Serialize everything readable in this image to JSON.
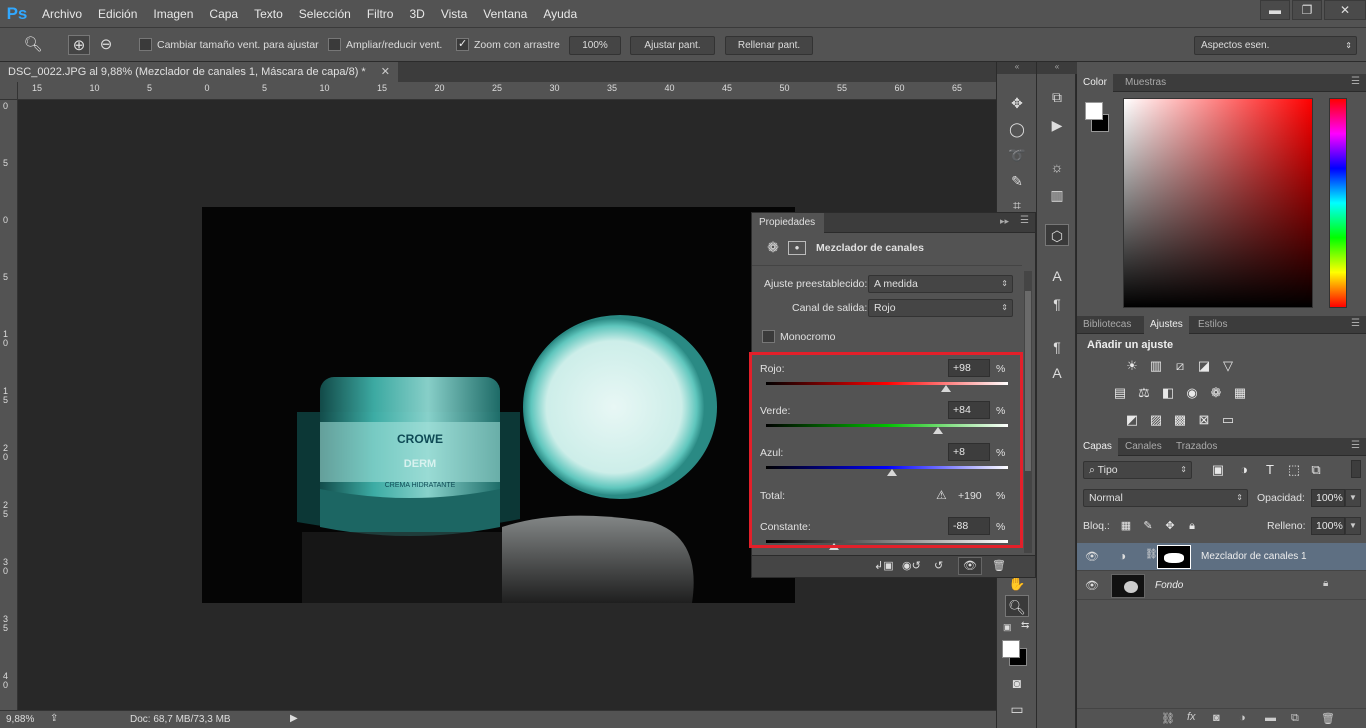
{
  "app": {
    "logo": "Ps",
    "menu": [
      "Archivo",
      "Edición",
      "Imagen",
      "Capa",
      "Texto",
      "Selección",
      "Filtro",
      "3D",
      "Vista",
      "Ventana",
      "Ayuda"
    ],
    "window_buttons": [
      "▬",
      "❐",
      "✕"
    ]
  },
  "options_bar": {
    "resize_windows_label": "Cambiar tamaño vent. para ajustar",
    "zoom_all_label": "Ampliar/reducir vent.",
    "scrubby_zoom_label": "Zoom con arrastre",
    "scrubby_zoom_checked": true,
    "btn_100": "100%",
    "btn_fit": "Ajustar pant.",
    "btn_fill": "Rellenar pant.",
    "workspace": "Aspectos esen."
  },
  "document": {
    "tab_title": "DSC_0022.JPG al 9,88% (Mezclador de canales 1, Máscara de capa/8) *",
    "tab_close": "✕",
    "zoom": "9,88%",
    "doc_size": "Doc: 68,7 MB/73,3 MB",
    "ruler_h": [
      "15",
      "10",
      "5",
      "0",
      "5",
      "10",
      "15",
      "20",
      "25",
      "30",
      "35",
      "40",
      "45",
      "50",
      "55",
      "60",
      "65"
    ],
    "ruler_v": [
      "0",
      "5",
      "0",
      "5",
      "1 0",
      "1 5",
      "2 0",
      "2 5",
      "3 0",
      "3 5",
      "4 0"
    ],
    "product_brand": "CROWE",
    "product_sub": "DERM",
    "product_text": "CREMA HIDRATANTE"
  },
  "properties": {
    "panel_title": "Propiedades",
    "title": "Mezclador de canales",
    "preset_label": "Ajuste preestablecido:",
    "preset_value": "A medida",
    "output_label": "Canal de salida:",
    "output_value": "Rojo",
    "monochrome_label": "Monocromo",
    "monochrome_checked": false,
    "red_label": "Rojo:",
    "red_value": "+98",
    "red_level": 98,
    "green_label": "Verde:",
    "green_value": "+84",
    "green_level": 84,
    "blue_label": "Azul:",
    "blue_value": "+8",
    "blue_level": 8,
    "total_label": "Total:",
    "total_value": "+190",
    "constant_label": "Constante:",
    "constant_value": "-88",
    "constant_level": -88,
    "percent": "%",
    "warning_icon": "⚠"
  },
  "color_panel": {
    "tabs": [
      "Color",
      "Muestras"
    ],
    "fg_color": "#ffffff",
    "bg_color": "#000000"
  },
  "adjustments_panel": {
    "tabs": [
      "Bibliotecas",
      "Ajustes",
      "Estilos"
    ],
    "heading": "Añadir un ajuste"
  },
  "layers_panel": {
    "tabs": [
      "Capas",
      "Canales",
      "Trazados"
    ],
    "filter": "Tipo",
    "blend_mode": "Normal",
    "opacity_label": "Opacidad:",
    "opacity_value": "100%",
    "lock_label": "Bloq.:",
    "fill_label": "Relleno:",
    "fill_value": "100%",
    "layers": [
      {
        "name": "Mezclador de canales 1",
        "selected": true
      },
      {
        "name": "Fondo",
        "selected": false
      }
    ]
  }
}
